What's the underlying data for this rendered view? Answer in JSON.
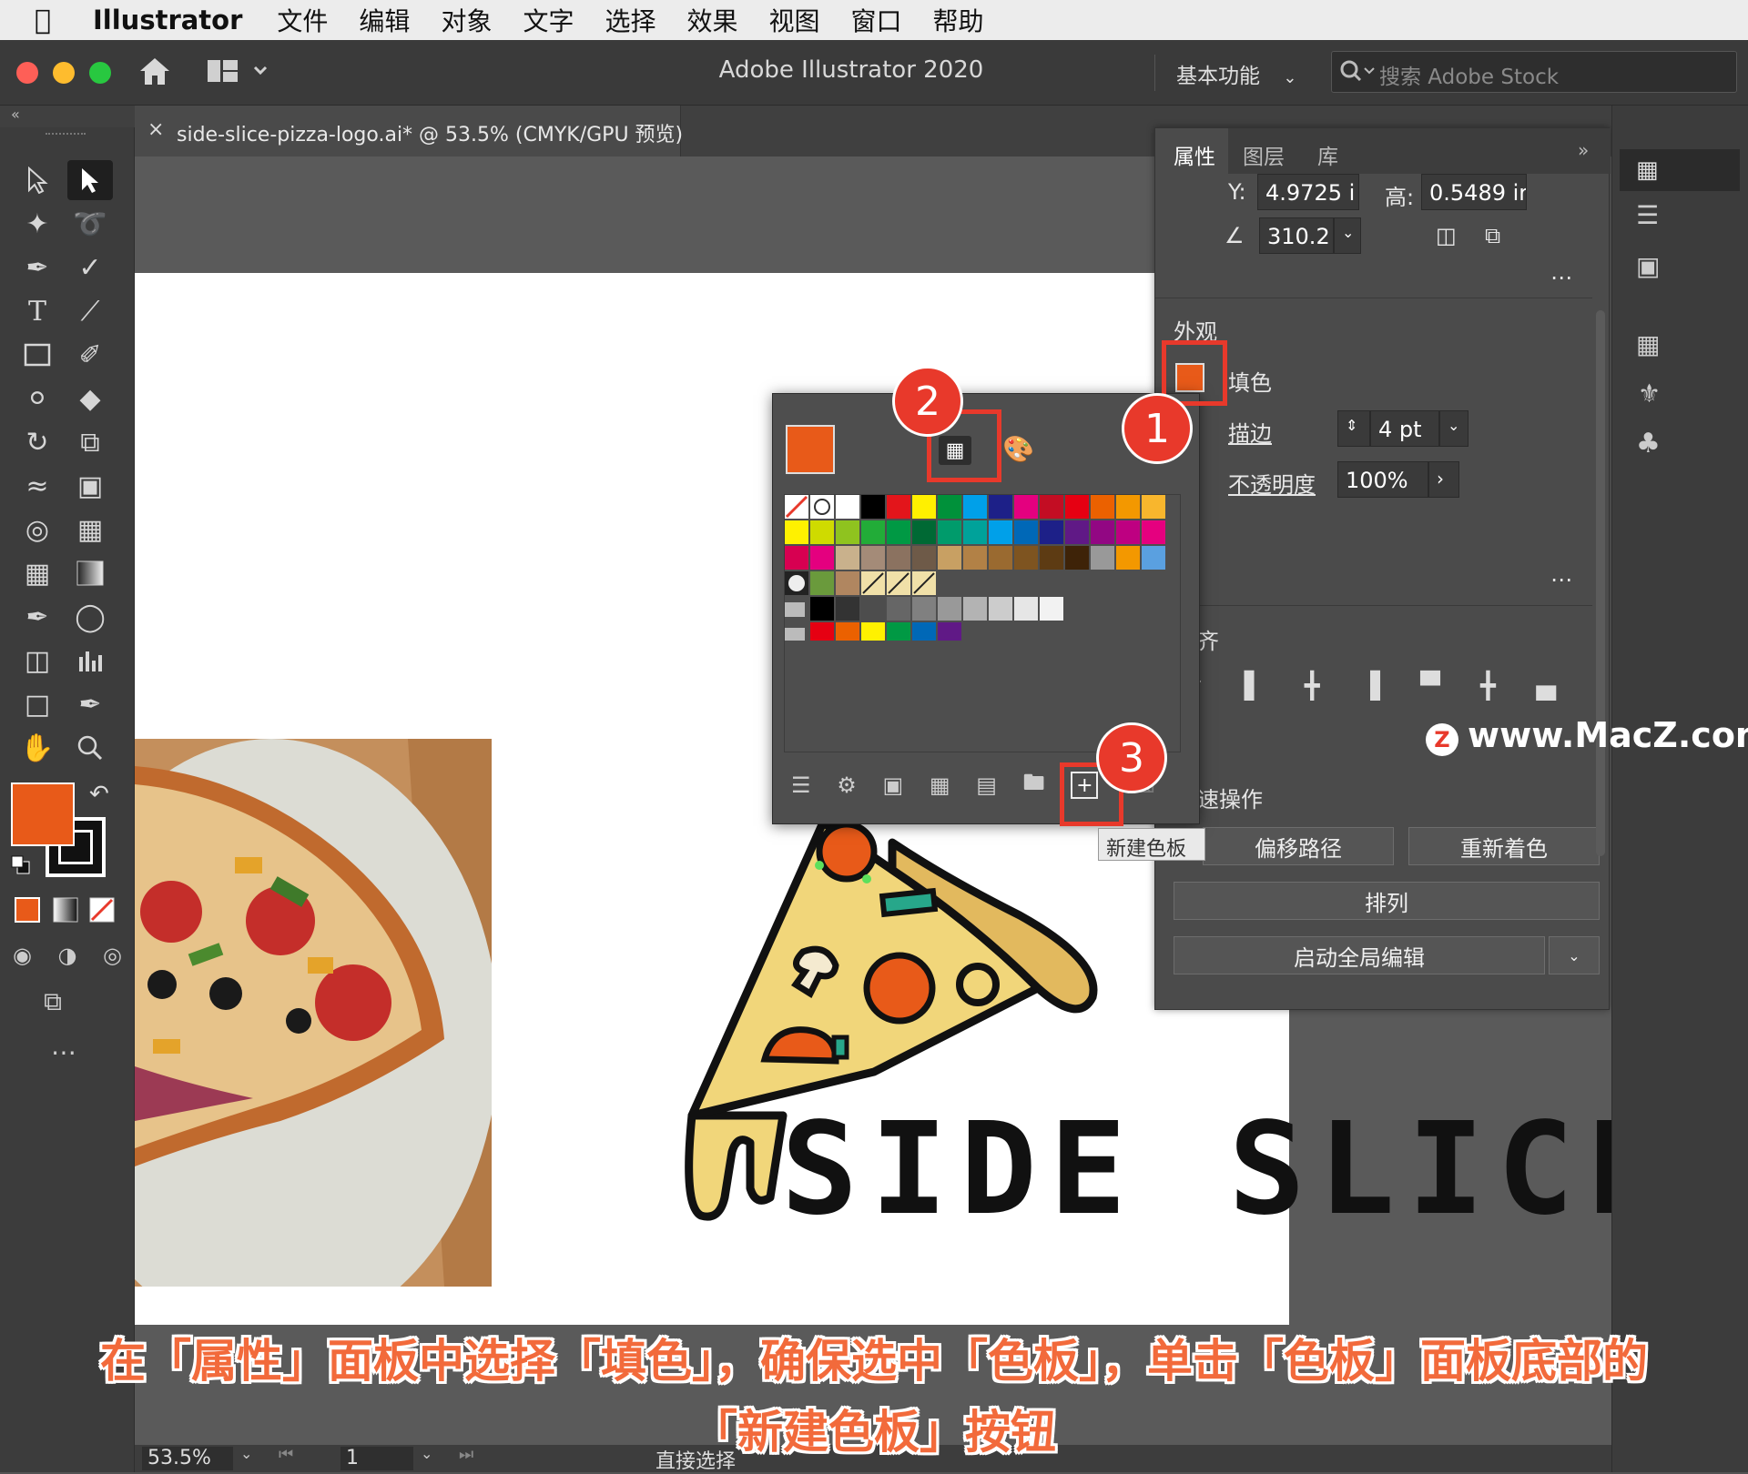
{
  "menubar": {
    "app": "Illustrator",
    "items": [
      "文件",
      "编辑",
      "对象",
      "文字",
      "选择",
      "效果",
      "视图",
      "窗口",
      "帮助"
    ]
  },
  "titlebar": {
    "title": "Adobe Illustrator 2020",
    "workspace": "基本功能",
    "search_placeholder": "搜索 Adobe Stock"
  },
  "document_tab": {
    "close": "×",
    "title": "side-slice-pizza-logo.ai* @ 53.5% (CMYK/GPU 预览)"
  },
  "properties_panel": {
    "tabs": [
      "属性",
      "图层",
      "库"
    ],
    "y_label": "Y:",
    "y_value": "4.9725 i",
    "h_label": "高:",
    "h_value": "0.5489 ir",
    "angle_value": "310.2",
    "appearance_title": "外观",
    "fill_label": "填色",
    "stroke_label": "描边",
    "stroke_value": "4 pt",
    "opacity_label": "不透明度",
    "opacity_value": "100%",
    "align_fragment": "齐",
    "quick_actions_fragment": "速操作",
    "buttons": {
      "offset_path": "偏移路径",
      "recolor": "重新着色",
      "arrange": "排列",
      "global_edit": "启动全局编辑"
    }
  },
  "swatches_popup": {
    "current_fill": "#e85a19",
    "new_swatch_tooltip": "新建色板"
  },
  "callouts": [
    "1",
    "2",
    "3"
  ],
  "caption": {
    "line1": "在「属性」面板中选择「填色」，确保选中「色板」，单击「色板」面板底部的",
    "line2": "「新建色板」按钮"
  },
  "watermark": "www.MacZ.com",
  "artwork": {
    "logo_text": "SIDE SLICE"
  },
  "statusbar": {
    "zoom": "53.5%",
    "page": "1",
    "tool": "直接选择"
  },
  "colors": {
    "accent_fill": "#e85a19",
    "callout_red": "#e8392b",
    "caption_orange": "#f26a3b"
  }
}
